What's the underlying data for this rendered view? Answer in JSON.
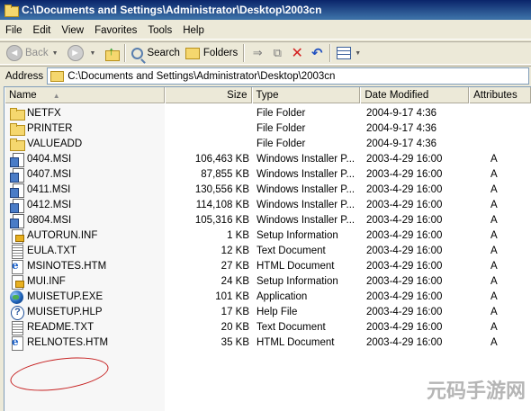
{
  "window": {
    "title": "C:\\Documents and Settings\\Administrator\\Desktop\\2003cn"
  },
  "menu": [
    "File",
    "Edit",
    "View",
    "Favorites",
    "Tools",
    "Help"
  ],
  "toolbar": {
    "back_label": "Back",
    "search_label": "Search",
    "folders_label": "Folders"
  },
  "address": {
    "label": "Address",
    "value": "C:\\Documents and Settings\\Administrator\\Desktop\\2003cn"
  },
  "columns": {
    "name": "Name",
    "size": "Size",
    "type": "Type",
    "date": "Date Modified",
    "attributes": "Attributes"
  },
  "files": [
    {
      "icon": "folder",
      "name": "NETFX",
      "size": "",
      "type": "File Folder",
      "date": "2004-9-17 4:36",
      "attr": ""
    },
    {
      "icon": "folder",
      "name": "PRINTER",
      "size": "",
      "type": "File Folder",
      "date": "2004-9-17 4:36",
      "attr": ""
    },
    {
      "icon": "folder",
      "name": "VALUEADD",
      "size": "",
      "type": "File Folder",
      "date": "2004-9-17 4:36",
      "attr": ""
    },
    {
      "icon": "msi",
      "name": "0404.MSI",
      "size": "106,463 KB",
      "type": "Windows Installer P...",
      "date": "2003-4-29 16:00",
      "attr": "A"
    },
    {
      "icon": "msi",
      "name": "0407.MSI",
      "size": "87,855 KB",
      "type": "Windows Installer P...",
      "date": "2003-4-29 16:00",
      "attr": "A"
    },
    {
      "icon": "msi",
      "name": "0411.MSI",
      "size": "130,556 KB",
      "type": "Windows Installer P...",
      "date": "2003-4-29 16:00",
      "attr": "A"
    },
    {
      "icon": "msi",
      "name": "0412.MSI",
      "size": "114,108 KB",
      "type": "Windows Installer P...",
      "date": "2003-4-29 16:00",
      "attr": "A"
    },
    {
      "icon": "msi",
      "name": "0804.MSI",
      "size": "105,316 KB",
      "type": "Windows Installer P...",
      "date": "2003-4-29 16:00",
      "attr": "A"
    },
    {
      "icon": "inf",
      "name": "AUTORUN.INF",
      "size": "1 KB",
      "type": "Setup Information",
      "date": "2003-4-29 16:00",
      "attr": "A"
    },
    {
      "icon": "txt",
      "name": "EULA.TXT",
      "size": "12 KB",
      "type": "Text Document",
      "date": "2003-4-29 16:00",
      "attr": "A"
    },
    {
      "icon": "htm",
      "name": "MSINOTES.HTM",
      "size": "27 KB",
      "type": "HTML Document",
      "date": "2003-4-29 16:00",
      "attr": "A"
    },
    {
      "icon": "inf",
      "name": "MUI.INF",
      "size": "24 KB",
      "type": "Setup Information",
      "date": "2003-4-29 16:00",
      "attr": "A"
    },
    {
      "icon": "exe",
      "name": "MUISETUP.EXE",
      "size": "101 KB",
      "type": "Application",
      "date": "2003-4-29 16:00",
      "attr": "A"
    },
    {
      "icon": "hlp",
      "name": "MUISETUP.HLP",
      "size": "17 KB",
      "type": "Help File",
      "date": "2003-4-29 16:00",
      "attr": "A"
    },
    {
      "icon": "txt",
      "name": "README.TXT",
      "size": "20 KB",
      "type": "Text Document",
      "date": "2003-4-29 16:00",
      "attr": "A"
    },
    {
      "icon": "htm",
      "name": "RELNOTES.HTM",
      "size": "35 KB",
      "type": "HTML Document",
      "date": "2003-4-29 16:00",
      "attr": "A"
    }
  ],
  "watermark": "元码手游网"
}
